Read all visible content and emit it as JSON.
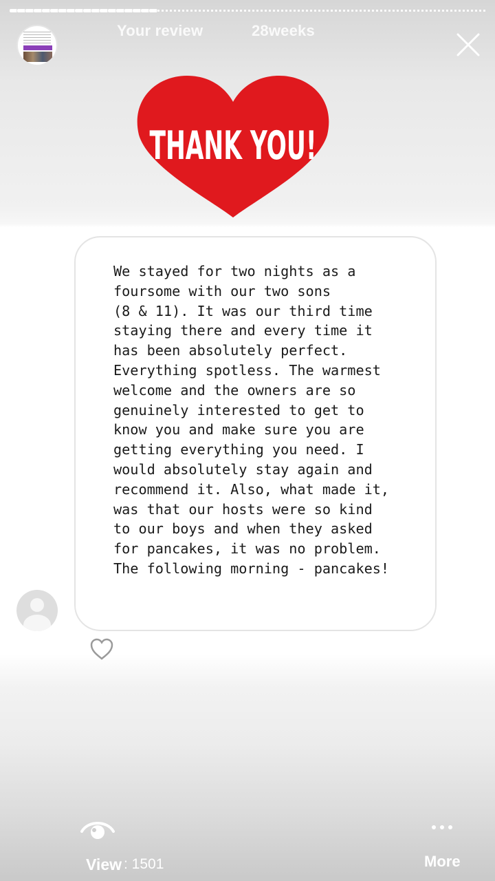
{
  "header": {
    "title": "Your review",
    "time_ago": "28weeks",
    "avatar_icon": "profile-thumbnail-icon",
    "close_icon": "close-icon"
  },
  "story": {
    "image_text": "THANK YOU!",
    "image_color": "#e0191e",
    "review_text": "We stayed for two nights as a\nfoursome with our two sons\n(8 & 11). It was our third time\nstaying there and every time it\nhas been absolutely perfect.\nEverything spotless. The warmest\nwelcome and the owners are so\ngenuinely interested to get to\nknow you and make sure you are\ngetting everything you need. I\nwould absolutely stay again and\nrecommend it. Also, what made it,\nwas that our hosts were so kind\nto our boys and when they asked\nfor pancakes, it was no problem.\nThe following morning - pancakes!"
  },
  "footer": {
    "view_label": "View",
    "view_count": ": 1501",
    "more_label": "More",
    "view_icon": "eye-icon",
    "more_icon": "more-dots-icon"
  }
}
